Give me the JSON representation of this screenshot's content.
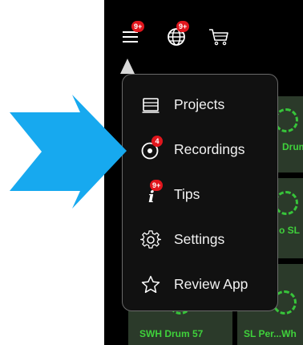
{
  "topbar": {
    "menu_badge": "9+",
    "globe_badge": "9+"
  },
  "menu": {
    "items": [
      {
        "label": "Projects",
        "icon": "projects-icon"
      },
      {
        "label": "Recordings",
        "icon": "recordings-icon",
        "badge": "4"
      },
      {
        "label": "Tips",
        "icon": "tips-icon",
        "badge": "9+"
      },
      {
        "label": "Settings",
        "icon": "gear-icon"
      },
      {
        "label": "Review App",
        "icon": "star-icon"
      }
    ]
  },
  "tiles": [
    {
      "label": "Drum"
    },
    {
      "label": "o SL"
    },
    {
      "label": "SWH Drum 57"
    },
    {
      "label": "SL Per...Wh"
    }
  ],
  "colors": {
    "accent_green": "#3fd13b",
    "badge_red": "#e0161d",
    "arrow_blue": "#17a9ef"
  }
}
